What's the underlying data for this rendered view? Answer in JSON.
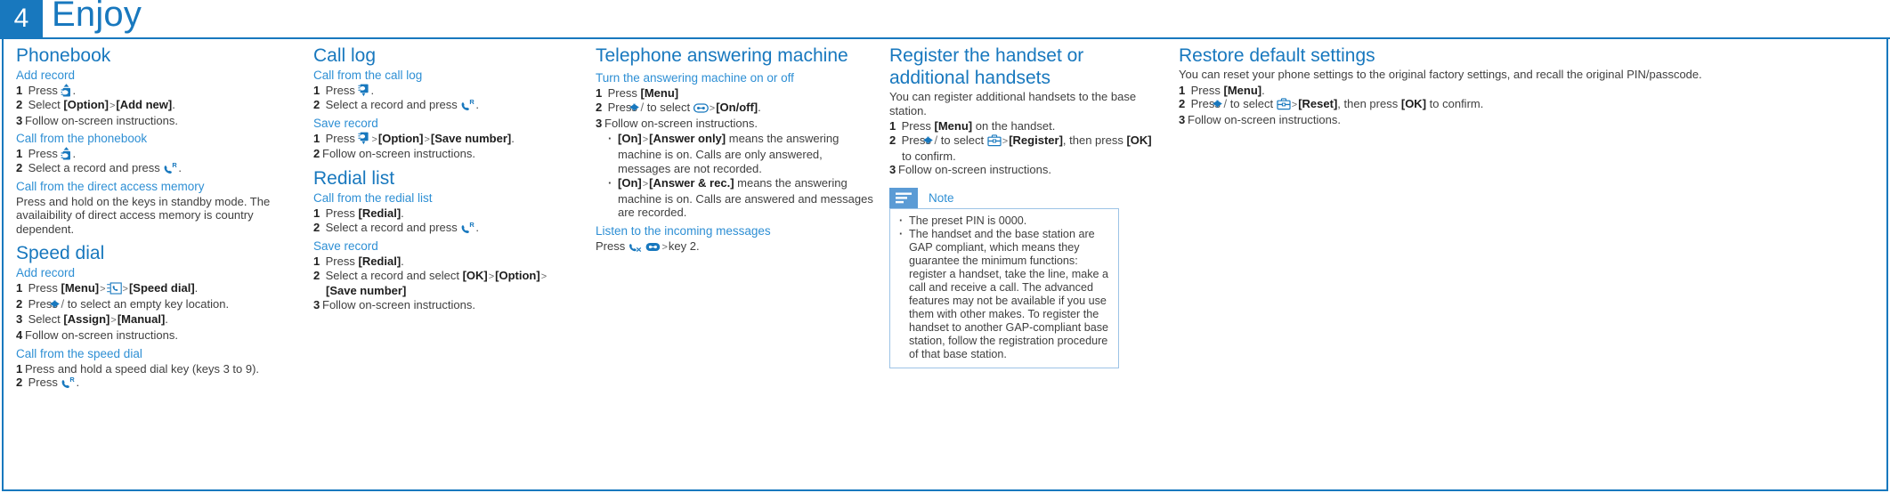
{
  "header": {
    "chapter_number": "4",
    "chapter_title": "Enjoy"
  },
  "columns": {
    "phonebook": {
      "title": "Phonebook",
      "add_record": {
        "heading": "Add record",
        "step1_pre": "Press",
        "step1_post": ".",
        "step2_pre": "Select",
        "step2_b1": "[Option]",
        "step2_sep": ">",
        "step2_b2": "[Add new]",
        "step2_post": ".",
        "step3": "Follow on-screen instructions."
      },
      "call_from_phonebook": {
        "heading": "Call from the phonebook",
        "step1_pre": "Press",
        "step1_post": ".",
        "step2_pre": "Select a record and press",
        "step2_post": "."
      },
      "direct_access": {
        "heading": "Call from the direct access memory",
        "body": "Press and hold on the keys in standby mode.  The availaibility of direct access memory is country dependent."
      }
    },
    "speed_dial": {
      "title": "Speed dial",
      "add_record": {
        "heading": "Add record",
        "step1_pre": "Press",
        "step1_b1": "[Menu]",
        "step1_sep1": ">",
        "step1_sep2": ">",
        "step1_b2": "[Speed dial]",
        "step1_post": ".",
        "step2_pre": "Press",
        "step2_mid": "to select an empty key location.",
        "step3_pre": "Select",
        "step3_b1": "[Assign]",
        "step3_sep": ">",
        "step3_b2": "[Manual]",
        "step3_post": ".",
        "step4": "Follow on-screen instructions."
      },
      "call_from_speed_dial": {
        "heading": "Call from the speed dial",
        "step1": "Press and hold a speed dial key (keys 3 to 9).",
        "step2_pre": "Press",
        "step2_post": "."
      }
    },
    "call_log": {
      "title": "Call log",
      "call_from_call_log": {
        "heading": "Call from the call log",
        "step1_pre": "Press",
        "step1_post": ".",
        "step2_pre": "Select a record and press",
        "step2_post": "."
      },
      "save_record": {
        "heading": "Save record",
        "step1_pre": "Press",
        "step1_sep1": ">",
        "step1_b1": "[Option]",
        "step1_sep2": ">",
        "step1_b2": "[Save number]",
        "step1_post": ".",
        "step2": "Follow on-screen instructions."
      }
    },
    "redial_list": {
      "title": "Redial list",
      "call_from_redial": {
        "heading": "Call from the redial list",
        "step1_pre": "Press",
        "step1_b1": "[Redial]",
        "step1_post": ".",
        "step2_pre": "Select a record and press",
        "step2_post": "."
      },
      "save_record": {
        "heading": "Save record",
        "step1_pre": "Press",
        "step1_b1": "[Redial]",
        "step1_post": ".",
        "step2_pre": "Select a record and select",
        "step2_b1": "[OK]",
        "step2_sep1": ">",
        "step2_b2": "[Option]",
        "step2_sep2": ">",
        "step2_b3": "[Save number]",
        "step3": "Follow on-screen instructions."
      }
    },
    "answering_machine": {
      "title": "Telephone answering machine",
      "turn_on_off": {
        "heading": "Turn the answering machine on or off",
        "step1_pre": "Press",
        "step1_b1": "[Menu]",
        "step2_pre": "Press",
        "step2_mid": "to select",
        "step2_sep": ">",
        "step2_b1": "[On/off]",
        "step2_post": ".",
        "step3": "Follow on-screen instructions.",
        "bullet1_b1": "[On]",
        "bullet1_sep": ">",
        "bullet1_b2": "[Answer only]",
        "bullet1_rest": " means the answering machine is on. Calls are only answered, messages are not recorded.",
        "bullet2_b1": "[On]",
        "bullet2_sep": ">",
        "bullet2_b2": "[Answer & rec.]",
        "bullet2_rest": " means the answering machine is on. Calls are answered and messages are recorded."
      },
      "listen": {
        "heading": "Listen to the incoming messages",
        "text_pre": "Press",
        "text_sep": ">",
        "text_post": "key 2."
      }
    },
    "register": {
      "title": "Register the handset or additional handsets",
      "intro": "You can register additional handsets to the base station.",
      "step1_pre": "Press",
      "step1_b1": "[Menu]",
      "step1_post": "on the handset.",
      "step2_pre": "Press",
      "step2_mid": "to select",
      "step2_sep": ">",
      "step2_b1": "[Register]",
      "step2_tail": ", then press",
      "step2_b2": "[OK]",
      "step2_post": "to confirm.",
      "step3": "Follow on-screen instructions.",
      "note": {
        "label": "Note",
        "items": [
          "The preset PIN is 0000.",
          "The handset and the base station are GAP compliant, which means they guarantee the minimum functions: register a handset, take the line, make a call and receive a call. The advanced features may not be available if you use them with other makes. To register the handset to another GAP-compliant base station, follow the registration procedure of that base station."
        ]
      }
    },
    "restore": {
      "title": "Restore default settings",
      "intro": "You can reset your phone settings to the original factory settings, and recall the original PIN/passcode.",
      "step1_pre": "Press",
      "step1_b1": "[Menu]",
      "step1_post": ".",
      "step2_pre": "Press",
      "step2_mid": "to select",
      "step2_sep": ">",
      "step2_b1": "[Reset]",
      "step2_tail": ", then press",
      "step2_b2": "[OK]",
      "step2_post": "to confirm.",
      "step3": "Follow on-screen instructions."
    }
  },
  "icons": {
    "phonebook": "phonebook-icon",
    "call": "call-key-icon",
    "call_log": "call-log-icon",
    "speed_dial": "speed-dial-icon",
    "answering_machine": "answering-machine-icon",
    "listen": "listen-messages-icon",
    "settings": "settings-toolbox-icon",
    "left_arrow": "left-arrow-icon",
    "right_arrow": "right-arrow-icon",
    "note": "note-lines-icon"
  },
  "colors": {
    "brand": "#1878be",
    "sub_heading": "#2e8fd4",
    "note_border": "#9dc3e6",
    "note_tab": "#5b9bd5",
    "text": "#3f3f3f"
  }
}
